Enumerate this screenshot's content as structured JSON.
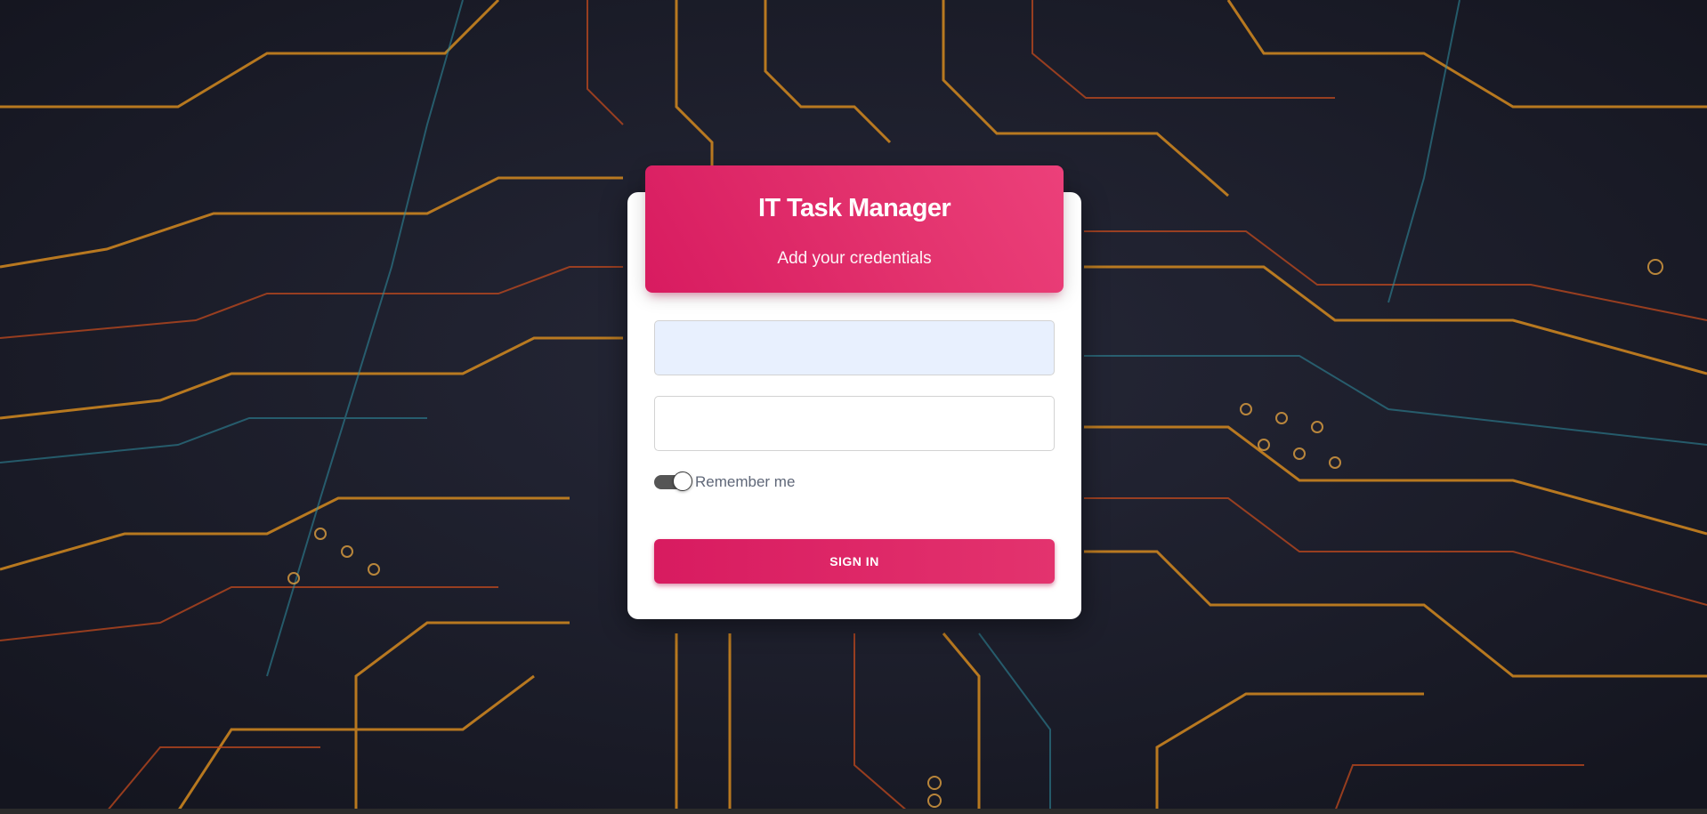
{
  "background": {
    "description_icon": "circuit-board-background"
  },
  "login": {
    "title": "IT Task Manager",
    "subtitle": "Add your credentials",
    "username": {
      "value": "",
      "placeholder": ""
    },
    "password": {
      "value": "",
      "placeholder": ""
    },
    "remember_me": {
      "label": "Remember me",
      "checked": true
    },
    "submit_label": "SIGN IN"
  },
  "colors": {
    "accent": "#e91e63",
    "accent_dark": "#d81b60",
    "autofill_bg": "#e8f0fe",
    "card_bg": "#ffffff",
    "label_text": "#5f6778"
  }
}
